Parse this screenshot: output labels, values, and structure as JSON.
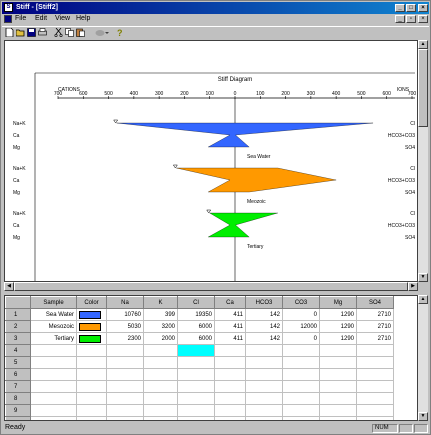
{
  "window": {
    "title": "Stiff - [Stiff2]",
    "min": "_",
    "max": "□",
    "close": "×",
    "mdi_min": "_",
    "mdi_restore": "▫",
    "mdi_close": "×"
  },
  "menu": [
    {
      "label": "File"
    },
    {
      "label": "Edit"
    },
    {
      "label": "View"
    },
    {
      "label": "Help"
    }
  ],
  "toolbar": {
    "icons": [
      "new-file-icon",
      "open-folder-icon",
      "save-icon",
      "print-icon",
      "cut-icon",
      "copy-icon",
      "paste-icon",
      "chart-icon",
      "help-icon"
    ]
  },
  "chart_data": {
    "type": "stiff",
    "title": "Stiff Diagram",
    "left_label": "CATIONS",
    "right_label": "IONS",
    "ticks": [
      700,
      600,
      500,
      400,
      300,
      200,
      100,
      0,
      100,
      200,
      300,
      400,
      500,
      600,
      700
    ],
    "xlim": [
      -700,
      700
    ],
    "rows": [
      {
        "left": "Na+K",
        "right": "Cl"
      },
      {
        "left": "Ca",
        "right": "HCO3+CO3"
      },
      {
        "left": "Mg",
        "right": "SO4"
      }
    ],
    "samples": [
      {
        "name": "Sea Water",
        "color": "#3366ff",
        "cations": [
          468,
          20,
          106
        ],
        "anions": [
          546,
          2,
          56
        ]
      },
      {
        "name": "Mesozoic",
        "color": "#ff9900",
        "cations": [
          232,
          20,
          106
        ],
        "anions": [
          169,
          400,
          56
        ]
      },
      {
        "name": "Tertiary",
        "color": "#00ee00",
        "cations": [
          100,
          20,
          106
        ],
        "anions": [
          169,
          2,
          56
        ]
      }
    ],
    "series_labels": [
      "Sea Water",
      "Meozoic",
      "Tertiary"
    ]
  },
  "grid": {
    "headers": [
      "",
      "Sample",
      "Color",
      "Na",
      "K",
      "Cl",
      "Ca",
      "HCO3",
      "CO3",
      "Mg",
      "SO4"
    ],
    "rows": [
      {
        "n": "1",
        "sample": "Sea Water",
        "color": "#3366ff",
        "na": "10760",
        "k": "399",
        "cl": "19350",
        "ca": "411",
        "hco3": "142",
        "co3": "0",
        "mg": "1290",
        "so4": "2710"
      },
      {
        "n": "2",
        "sample": "Mesozoic",
        "color": "#ff9900",
        "na": "5030",
        "k": "3200",
        "cl": "6000",
        "ca": "411",
        "hco3": "142",
        "co3": "12000",
        "mg": "1290",
        "so4": "2710"
      },
      {
        "n": "3",
        "sample": "Tertiary",
        "color": "#00ee00",
        "na": "2300",
        "k": "2000",
        "cl": "6000",
        "ca": "411",
        "hco3": "142",
        "co3": "0",
        "mg": "1290",
        "so4": "2710"
      },
      {
        "n": "4"
      },
      {
        "n": "5"
      },
      {
        "n": "6"
      },
      {
        "n": "7"
      },
      {
        "n": "8"
      },
      {
        "n": "9"
      },
      {
        "n": "10"
      }
    ],
    "selected_cell_color": "#00ffff"
  },
  "status": {
    "text": "Ready",
    "num": "NUM"
  }
}
